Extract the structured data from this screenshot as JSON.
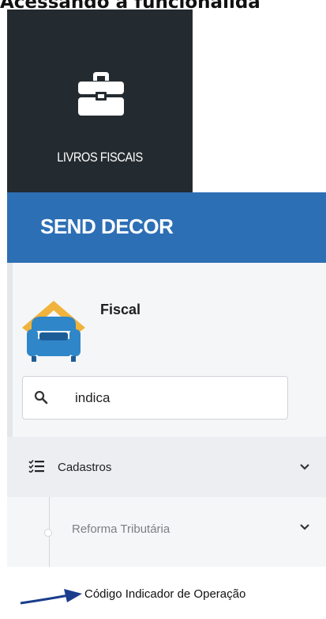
{
  "page": {
    "heading": "Acessando a funcionalida"
  },
  "tile": {
    "label": "LIVROS FISCAIS",
    "icon": "briefcase-icon",
    "background": "#242b30"
  },
  "banner": {
    "title": "SEND DECOR",
    "background": "#2d6fb5"
  },
  "module": {
    "title": "Fiscal",
    "logo": "armchair-house-icon"
  },
  "search": {
    "value": "indica",
    "icon": "search-icon"
  },
  "menu": {
    "group": {
      "label": "Cadastros",
      "icon": "list-checks-icon",
      "state": "expanded"
    },
    "subgroup": {
      "label": "Reforma Tributária",
      "state": "expanded"
    },
    "item": {
      "label": "Código Indicador de Operação"
    }
  },
  "annotation": {
    "icon": "arrow-right-icon",
    "color": "#1b3d8c"
  }
}
